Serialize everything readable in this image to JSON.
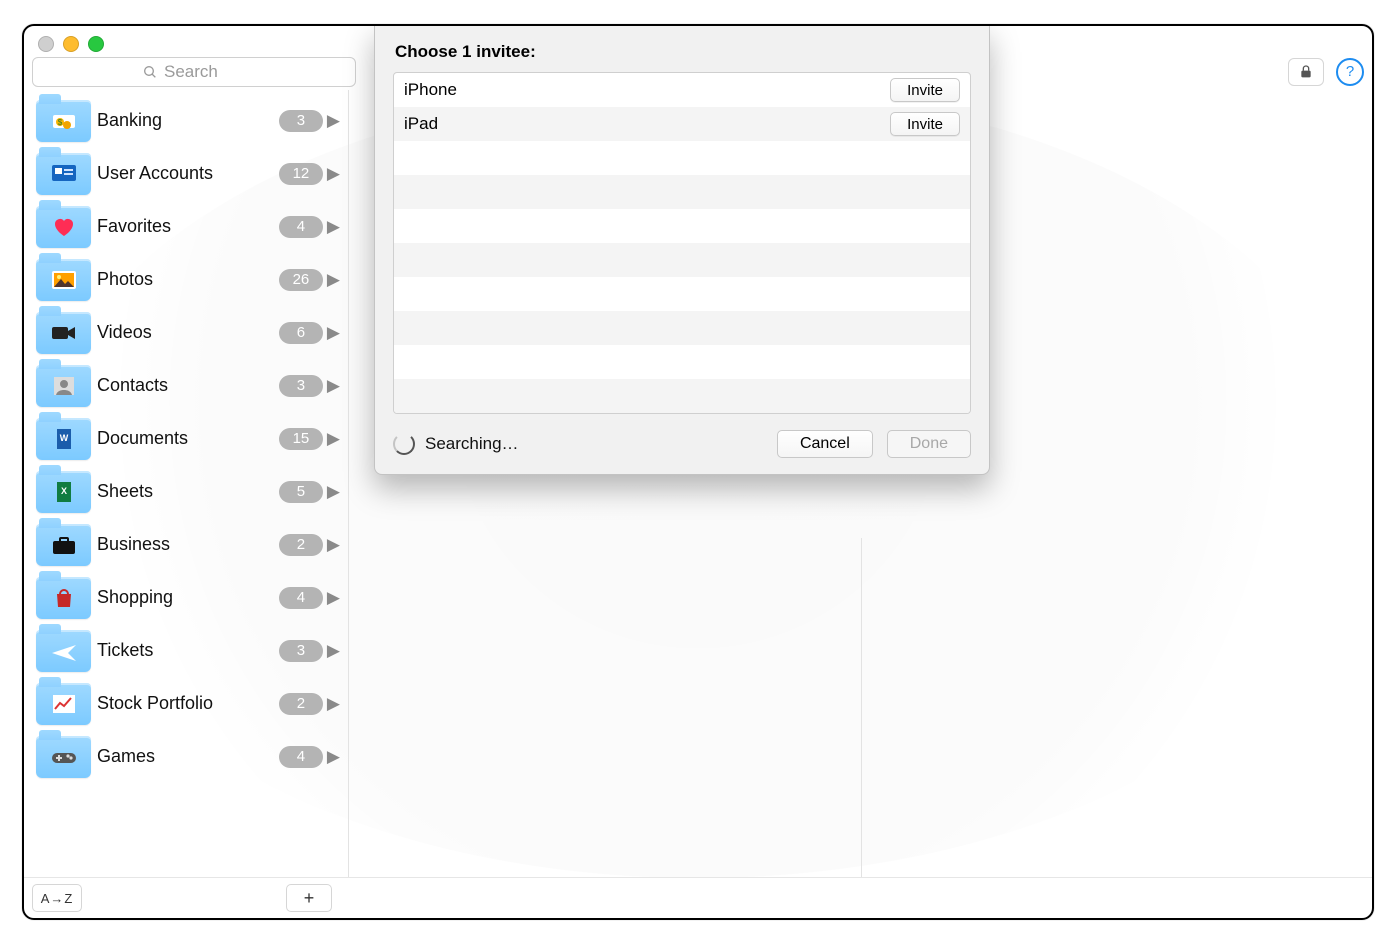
{
  "search": {
    "placeholder": "Search"
  },
  "toolbar": {
    "sort_label": "A→Z"
  },
  "sidebar": {
    "items": [
      {
        "label": "Banking",
        "count": "3",
        "icon": "banking"
      },
      {
        "label": "User Accounts",
        "count": "12",
        "icon": "id"
      },
      {
        "label": "Favorites",
        "count": "4",
        "icon": "heart"
      },
      {
        "label": "Photos",
        "count": "26",
        "icon": "photos"
      },
      {
        "label": "Videos",
        "count": "6",
        "icon": "video"
      },
      {
        "label": "Contacts",
        "count": "3",
        "icon": "contact"
      },
      {
        "label": "Documents",
        "count": "15",
        "icon": "doc"
      },
      {
        "label": "Sheets",
        "count": "5",
        "icon": "sheet"
      },
      {
        "label": "Business",
        "count": "2",
        "icon": "briefcase"
      },
      {
        "label": "Shopping",
        "count": "4",
        "icon": "bag"
      },
      {
        "label": "Tickets",
        "count": "3",
        "icon": "plane"
      },
      {
        "label": "Stock Portfolio",
        "count": "2",
        "icon": "stock"
      },
      {
        "label": "Games",
        "count": "4",
        "icon": "gamepad"
      }
    ]
  },
  "dialog": {
    "title": "Choose 1 invitee:",
    "invite_label": "Invite",
    "devices": [
      {
        "name": "iPhone"
      },
      {
        "name": "iPad"
      }
    ],
    "status": "Searching…",
    "cancel_label": "Cancel",
    "done_label": "Done"
  }
}
